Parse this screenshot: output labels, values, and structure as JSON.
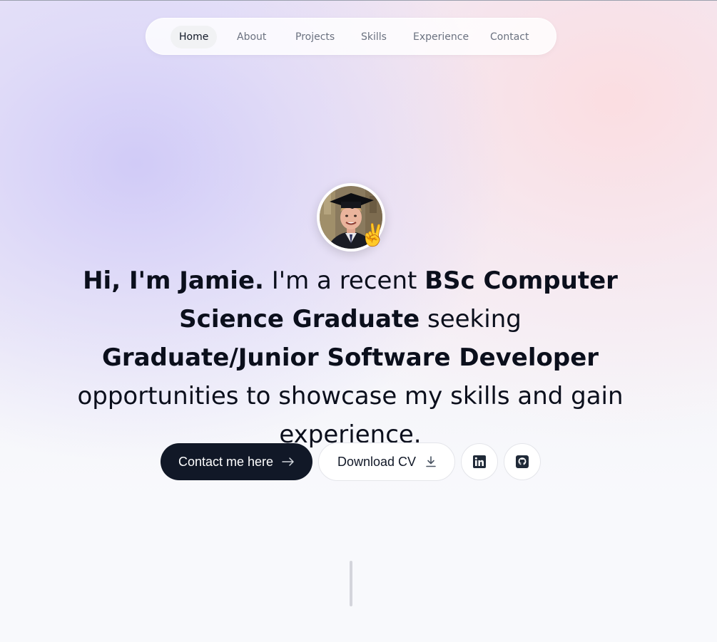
{
  "nav": {
    "items": [
      {
        "label": "Home",
        "active": true
      },
      {
        "label": "About",
        "active": false
      },
      {
        "label": "Projects",
        "active": false
      },
      {
        "label": "Skills",
        "active": false
      },
      {
        "label": "Experience",
        "active": false
      },
      {
        "label": "Contact",
        "active": false
      }
    ]
  },
  "hero": {
    "emoji": "✌️",
    "headline": {
      "greeting": "Hi, I'm Jamie.",
      "part1": " I'm a recent ",
      "degree": "BSc Computer Science Graduate",
      "part2": " seeking ",
      "role": "Graduate/Junior Software Developer",
      "part3": " opportunities to showcase my skills and gain experience."
    }
  },
  "actions": {
    "contact_label": "Contact me here",
    "cv_label": "Download CV",
    "contact_icon": "arrow-right-icon",
    "cv_icon": "download-icon",
    "linkedin_icon": "linkedin-icon",
    "github_icon": "github-icon"
  },
  "colors": {
    "primary_button": "#111827",
    "text": "#0b0f1c",
    "nav_text": "#6b7280",
    "gradient_left": "#cfc9f7",
    "gradient_right": "#fcdde0"
  }
}
